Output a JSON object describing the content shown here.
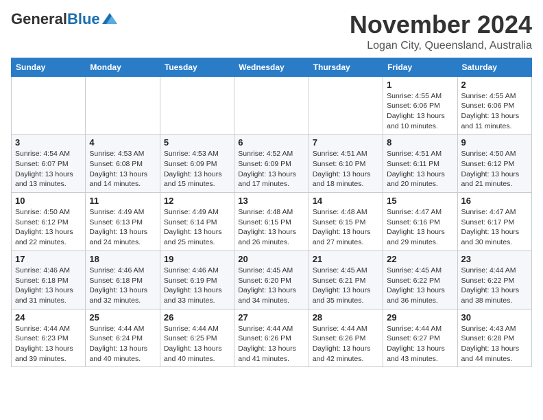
{
  "logo": {
    "general": "General",
    "blue": "Blue"
  },
  "title": "November 2024",
  "location": "Logan City, Queensland, Australia",
  "weekdays": [
    "Sunday",
    "Monday",
    "Tuesday",
    "Wednesday",
    "Thursday",
    "Friday",
    "Saturday"
  ],
  "weeks": [
    [
      {
        "day": "",
        "info": ""
      },
      {
        "day": "",
        "info": ""
      },
      {
        "day": "",
        "info": ""
      },
      {
        "day": "",
        "info": ""
      },
      {
        "day": "",
        "info": ""
      },
      {
        "day": "1",
        "info": "Sunrise: 4:55 AM\nSunset: 6:06 PM\nDaylight: 13 hours\nand 10 minutes."
      },
      {
        "day": "2",
        "info": "Sunrise: 4:55 AM\nSunset: 6:06 PM\nDaylight: 13 hours\nand 11 minutes."
      }
    ],
    [
      {
        "day": "3",
        "info": "Sunrise: 4:54 AM\nSunset: 6:07 PM\nDaylight: 13 hours\nand 13 minutes."
      },
      {
        "day": "4",
        "info": "Sunrise: 4:53 AM\nSunset: 6:08 PM\nDaylight: 13 hours\nand 14 minutes."
      },
      {
        "day": "5",
        "info": "Sunrise: 4:53 AM\nSunset: 6:09 PM\nDaylight: 13 hours\nand 15 minutes."
      },
      {
        "day": "6",
        "info": "Sunrise: 4:52 AM\nSunset: 6:09 PM\nDaylight: 13 hours\nand 17 minutes."
      },
      {
        "day": "7",
        "info": "Sunrise: 4:51 AM\nSunset: 6:10 PM\nDaylight: 13 hours\nand 18 minutes."
      },
      {
        "day": "8",
        "info": "Sunrise: 4:51 AM\nSunset: 6:11 PM\nDaylight: 13 hours\nand 20 minutes."
      },
      {
        "day": "9",
        "info": "Sunrise: 4:50 AM\nSunset: 6:12 PM\nDaylight: 13 hours\nand 21 minutes."
      }
    ],
    [
      {
        "day": "10",
        "info": "Sunrise: 4:50 AM\nSunset: 6:12 PM\nDaylight: 13 hours\nand 22 minutes."
      },
      {
        "day": "11",
        "info": "Sunrise: 4:49 AM\nSunset: 6:13 PM\nDaylight: 13 hours\nand 24 minutes."
      },
      {
        "day": "12",
        "info": "Sunrise: 4:49 AM\nSunset: 6:14 PM\nDaylight: 13 hours\nand 25 minutes."
      },
      {
        "day": "13",
        "info": "Sunrise: 4:48 AM\nSunset: 6:15 PM\nDaylight: 13 hours\nand 26 minutes."
      },
      {
        "day": "14",
        "info": "Sunrise: 4:48 AM\nSunset: 6:15 PM\nDaylight: 13 hours\nand 27 minutes."
      },
      {
        "day": "15",
        "info": "Sunrise: 4:47 AM\nSunset: 6:16 PM\nDaylight: 13 hours\nand 29 minutes."
      },
      {
        "day": "16",
        "info": "Sunrise: 4:47 AM\nSunset: 6:17 PM\nDaylight: 13 hours\nand 30 minutes."
      }
    ],
    [
      {
        "day": "17",
        "info": "Sunrise: 4:46 AM\nSunset: 6:18 PM\nDaylight: 13 hours\nand 31 minutes."
      },
      {
        "day": "18",
        "info": "Sunrise: 4:46 AM\nSunset: 6:18 PM\nDaylight: 13 hours\nand 32 minutes."
      },
      {
        "day": "19",
        "info": "Sunrise: 4:46 AM\nSunset: 6:19 PM\nDaylight: 13 hours\nand 33 minutes."
      },
      {
        "day": "20",
        "info": "Sunrise: 4:45 AM\nSunset: 6:20 PM\nDaylight: 13 hours\nand 34 minutes."
      },
      {
        "day": "21",
        "info": "Sunrise: 4:45 AM\nSunset: 6:21 PM\nDaylight: 13 hours\nand 35 minutes."
      },
      {
        "day": "22",
        "info": "Sunrise: 4:45 AM\nSunset: 6:22 PM\nDaylight: 13 hours\nand 36 minutes."
      },
      {
        "day": "23",
        "info": "Sunrise: 4:44 AM\nSunset: 6:22 PM\nDaylight: 13 hours\nand 38 minutes."
      }
    ],
    [
      {
        "day": "24",
        "info": "Sunrise: 4:44 AM\nSunset: 6:23 PM\nDaylight: 13 hours\nand 39 minutes."
      },
      {
        "day": "25",
        "info": "Sunrise: 4:44 AM\nSunset: 6:24 PM\nDaylight: 13 hours\nand 40 minutes."
      },
      {
        "day": "26",
        "info": "Sunrise: 4:44 AM\nSunset: 6:25 PM\nDaylight: 13 hours\nand 40 minutes."
      },
      {
        "day": "27",
        "info": "Sunrise: 4:44 AM\nSunset: 6:26 PM\nDaylight: 13 hours\nand 41 minutes."
      },
      {
        "day": "28",
        "info": "Sunrise: 4:44 AM\nSunset: 6:26 PM\nDaylight: 13 hours\nand 42 minutes."
      },
      {
        "day": "29",
        "info": "Sunrise: 4:44 AM\nSunset: 6:27 PM\nDaylight: 13 hours\nand 43 minutes."
      },
      {
        "day": "30",
        "info": "Sunrise: 4:43 AM\nSunset: 6:28 PM\nDaylight: 13 hours\nand 44 minutes."
      }
    ]
  ]
}
